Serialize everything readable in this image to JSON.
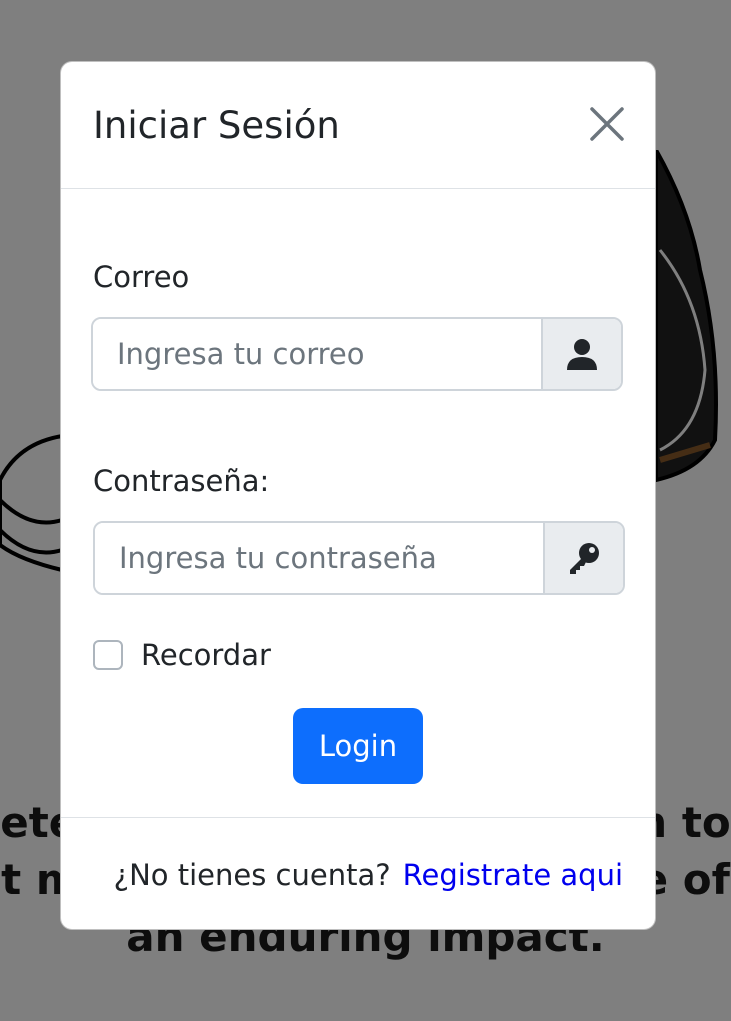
{
  "background": {
    "lines": [
      "ete",
      "n to",
      "t m",
      "e of",
      "an enduring impact."
    ]
  },
  "modal": {
    "title": "Iniciar Sesión",
    "email": {
      "label": "Correo",
      "placeholder": "Ingresa tu correo",
      "addon_icon": "user-icon"
    },
    "password": {
      "label": "Contraseña:",
      "placeholder": "Ingresa tu contraseña",
      "addon_icon": "key-icon"
    },
    "remember_label": "Recordar",
    "login_label": "Login",
    "footer": {
      "text": "¿No tienes cuenta?",
      "link": "Registrate aqui"
    }
  },
  "colors": {
    "primary": "#0d6efd",
    "link": "#0000ee",
    "backdrop": "rgba(0,0,0,0.5)"
  }
}
